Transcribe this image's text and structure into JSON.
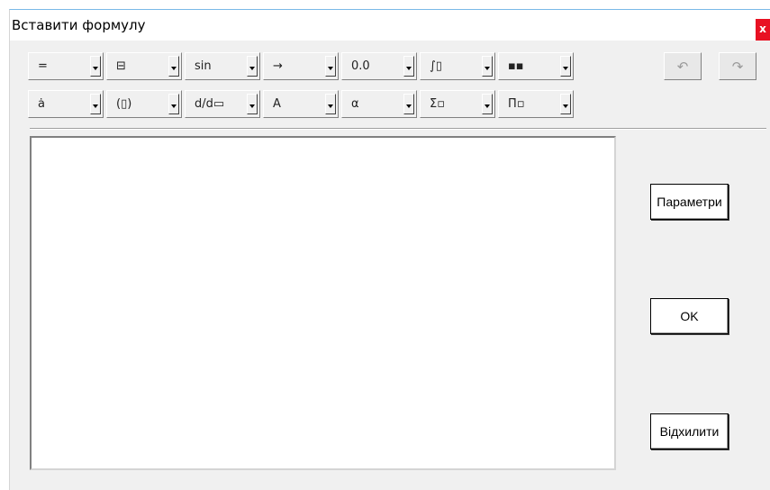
{
  "window": {
    "title": "Вставити формулу",
    "close_label": "x"
  },
  "toolbar": {
    "row1": [
      {
        "name": "relations-palette",
        "label": "="
      },
      {
        "name": "fraction-palette",
        "label": "⊟"
      },
      {
        "name": "functions-palette",
        "label": "sin"
      },
      {
        "name": "arrows-palette",
        "label": "→"
      },
      {
        "name": "numbers-palette",
        "label": "0.0"
      },
      {
        "name": "integrals-palette",
        "label": "∫▯"
      },
      {
        "name": "matrix-palette",
        "label": "▪▪"
      }
    ],
    "row2": [
      {
        "name": "accents-palette",
        "label": "ȧ"
      },
      {
        "name": "brackets-palette",
        "label": "(▯)"
      },
      {
        "name": "derivatives-palette",
        "label": "d/d▭"
      },
      {
        "name": "fonts-palette",
        "label": "A"
      },
      {
        "name": "greek-palette",
        "label": "α"
      },
      {
        "name": "sums-palette",
        "label": "Σ̇▫"
      },
      {
        "name": "products-palette",
        "label": "Π̇▫"
      }
    ],
    "undo_icon": "undo-icon",
    "redo_icon": "redo-icon",
    "undo_label": "↶",
    "redo_label": "↷"
  },
  "buttons": {
    "parameters": "Параметри",
    "ok": "OK",
    "cancel": "Відхилити"
  },
  "colors": {
    "accent_title_border": "#7ab9e8",
    "close_button": "#e81123",
    "dialog_background": "#f0f0f0"
  }
}
